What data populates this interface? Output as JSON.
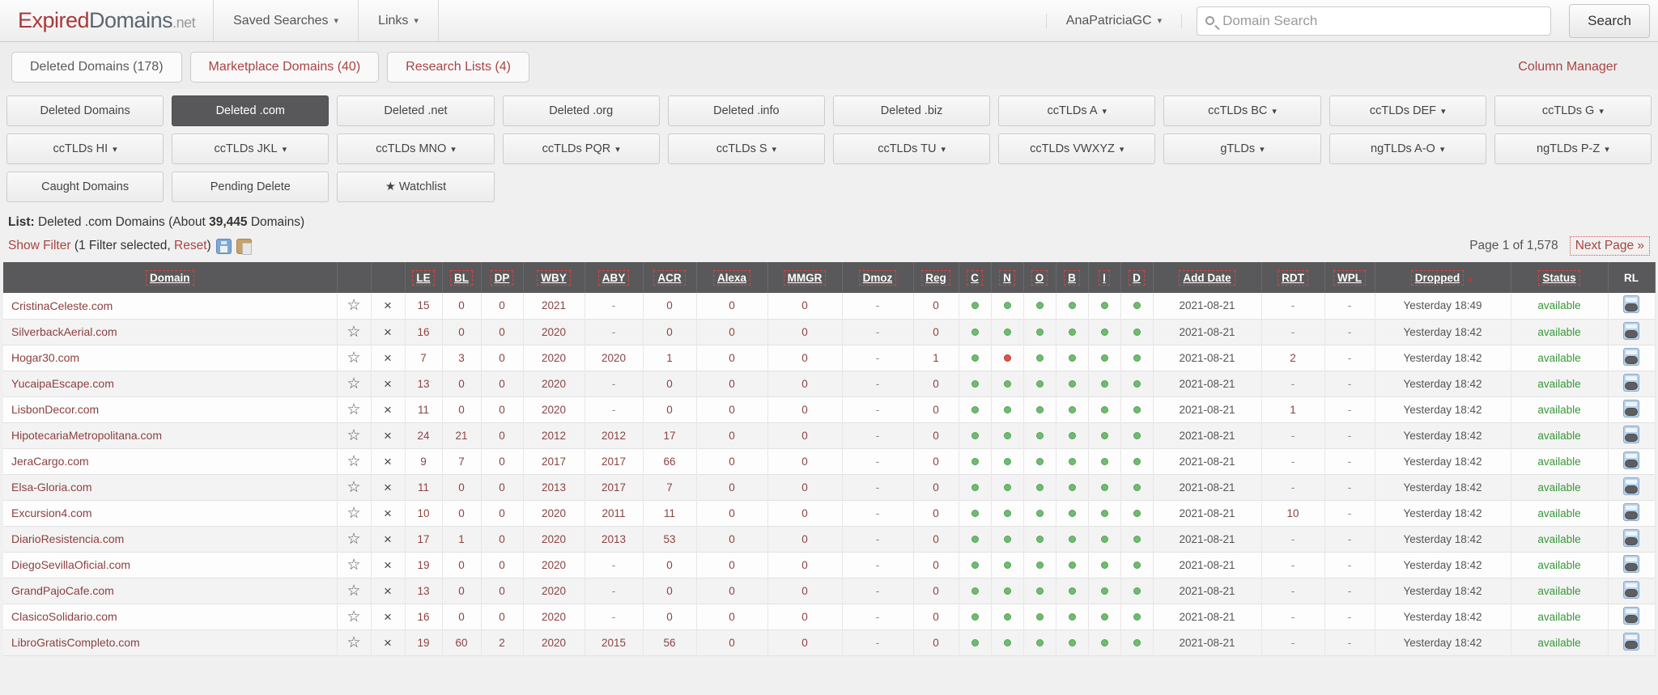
{
  "colors": {
    "accent_red": "#a94442",
    "link_maroon": "#8d4343",
    "status_green": "#389738",
    "dot_green": "#6fbb6f",
    "dot_red": "#d9534f",
    "header_bg": "#59595b"
  },
  "navbar": {
    "logo": {
      "part1": "Expired",
      "part2": "Domains",
      "part3": ".net"
    },
    "menus": [
      {
        "label": "Saved Searches"
      },
      {
        "label": "Links"
      }
    ],
    "user": "AnaPatriciaGC",
    "search": {
      "placeholder": "Domain Search",
      "button": "Search"
    }
  },
  "tabs": [
    {
      "label": "Deleted Domains (178)",
      "active": true
    },
    {
      "label": "Marketplace Domains (40)",
      "active": false
    },
    {
      "label": "Research Lists (4)",
      "active": false
    }
  ],
  "column_manager": "Column Manager",
  "filter_buttons": [
    {
      "label": "Deleted Domains",
      "dropdown": false,
      "active": false
    },
    {
      "label": "Deleted .com",
      "dropdown": false,
      "active": true
    },
    {
      "label": "Deleted .net",
      "dropdown": false,
      "active": false
    },
    {
      "label": "Deleted .org",
      "dropdown": false,
      "active": false
    },
    {
      "label": "Deleted .info",
      "dropdown": false,
      "active": false
    },
    {
      "label": "Deleted .biz",
      "dropdown": false,
      "active": false
    },
    {
      "label": "ccTLDs A",
      "dropdown": true,
      "active": false
    },
    {
      "label": "ccTLDs BC",
      "dropdown": true,
      "active": false
    },
    {
      "label": "ccTLDs DEF",
      "dropdown": true,
      "active": false
    },
    {
      "label": "ccTLDs G",
      "dropdown": true,
      "active": false
    },
    {
      "label": "ccTLDs HI",
      "dropdown": true,
      "active": false
    },
    {
      "label": "ccTLDs JKL",
      "dropdown": true,
      "active": false
    },
    {
      "label": "ccTLDs MNO",
      "dropdown": true,
      "active": false
    },
    {
      "label": "ccTLDs PQR",
      "dropdown": true,
      "active": false
    },
    {
      "label": "ccTLDs S",
      "dropdown": true,
      "active": false
    },
    {
      "label": "ccTLDs TU",
      "dropdown": true,
      "active": false
    },
    {
      "label": "ccTLDs VWXYZ",
      "dropdown": true,
      "active": false
    },
    {
      "label": "gTLDs",
      "dropdown": true,
      "active": false
    },
    {
      "label": "ngTLDs A-O",
      "dropdown": true,
      "active": false
    },
    {
      "label": "ngTLDs P-Z",
      "dropdown": true,
      "active": false
    },
    {
      "label": "Caught Domains",
      "dropdown": false,
      "active": false
    },
    {
      "label": "Pending Delete",
      "dropdown": false,
      "active": false
    },
    {
      "label": "★ Watchlist",
      "dropdown": false,
      "active": false
    }
  ],
  "list_info": {
    "label": "List:",
    "text_before": " Deleted .com Domains (About ",
    "count": "39,445",
    "text_after": " Domains)"
  },
  "filter_bar": {
    "show_filter": "Show Filter",
    "mid": " (1 Filter selected, ",
    "reset": "Reset",
    "close": ")"
  },
  "pagination": {
    "page_info": "Page 1 of 1,578",
    "next": "Next Page »"
  },
  "table": {
    "columns": [
      {
        "key": "domain",
        "label": "Domain",
        "sortable": true
      },
      {
        "key": "favorite",
        "label": "",
        "sortable": false
      },
      {
        "key": "delete",
        "label": "",
        "sortable": false
      },
      {
        "key": "le",
        "label": "LE",
        "sortable": true
      },
      {
        "key": "bl",
        "label": "BL",
        "sortable": true
      },
      {
        "key": "dp",
        "label": "DP",
        "sortable": true
      },
      {
        "key": "wby",
        "label": "WBY",
        "sortable": true
      },
      {
        "key": "aby",
        "label": "ABY",
        "sortable": true
      },
      {
        "key": "acr",
        "label": "ACR",
        "sortable": true
      },
      {
        "key": "alexa",
        "label": "Alexa",
        "sortable": true
      },
      {
        "key": "mmgr",
        "label": "MMGR",
        "sortable": true
      },
      {
        "key": "dmoz",
        "label": "Dmoz",
        "sortable": true
      },
      {
        "key": "reg",
        "label": "Reg",
        "sortable": true
      },
      {
        "key": "c",
        "label": "C",
        "sortable": true
      },
      {
        "key": "n",
        "label": "N",
        "sortable": true
      },
      {
        "key": "o",
        "label": "O",
        "sortable": true
      },
      {
        "key": "b",
        "label": "B",
        "sortable": true
      },
      {
        "key": "i",
        "label": "I",
        "sortable": true
      },
      {
        "key": "d",
        "label": "D",
        "sortable": true
      },
      {
        "key": "add_date",
        "label": "Add Date",
        "sortable": true
      },
      {
        "key": "rdt",
        "label": "RDT",
        "sortable": true
      },
      {
        "key": "wpl",
        "label": "WPL",
        "sortable": true
      },
      {
        "key": "dropped",
        "label": "Dropped",
        "sortable": true,
        "sorted": true
      },
      {
        "key": "status",
        "label": "Status",
        "sortable": true
      },
      {
        "key": "rl",
        "label": "RL",
        "sortable": false
      }
    ],
    "rows": [
      {
        "domain": "CristinaCeleste.com",
        "le": "15",
        "bl": "0",
        "dp": "0",
        "wby": "2021",
        "aby": "-",
        "acr": "0",
        "alexa": "0",
        "mmgr": "0",
        "dmoz": "-",
        "reg": "0",
        "dots": [
          "g",
          "g",
          "g",
          "g",
          "g",
          "g"
        ],
        "add_date": "2021-08-21",
        "rdt": "-",
        "wpl": "-",
        "dropped": "Yesterday 18:49",
        "status": "available"
      },
      {
        "domain": "SilverbackAerial.com",
        "le": "16",
        "bl": "0",
        "dp": "0",
        "wby": "2020",
        "aby": "-",
        "acr": "0",
        "alexa": "0",
        "mmgr": "0",
        "dmoz": "-",
        "reg": "0",
        "dots": [
          "g",
          "g",
          "g",
          "g",
          "g",
          "g"
        ],
        "add_date": "2021-08-21",
        "rdt": "-",
        "wpl": "-",
        "dropped": "Yesterday 18:42",
        "status": "available"
      },
      {
        "domain": "Hogar30.com",
        "le": "7",
        "bl": "3",
        "dp": "0",
        "wby": "2020",
        "aby": "2020",
        "acr": "1",
        "alexa": "0",
        "mmgr": "0",
        "dmoz": "-",
        "reg": "1",
        "dots": [
          "g",
          "r",
          "g",
          "g",
          "g",
          "g"
        ],
        "add_date": "2021-08-21",
        "rdt": "2",
        "wpl": "-",
        "dropped": "Yesterday 18:42",
        "status": "available"
      },
      {
        "domain": "YucaipaEscape.com",
        "le": "13",
        "bl": "0",
        "dp": "0",
        "wby": "2020",
        "aby": "-",
        "acr": "0",
        "alexa": "0",
        "mmgr": "0",
        "dmoz": "-",
        "reg": "0",
        "dots": [
          "g",
          "g",
          "g",
          "g",
          "g",
          "g"
        ],
        "add_date": "2021-08-21",
        "rdt": "-",
        "wpl": "-",
        "dropped": "Yesterday 18:42",
        "status": "available"
      },
      {
        "domain": "LisbonDecor.com",
        "le": "11",
        "bl": "0",
        "dp": "0",
        "wby": "2020",
        "aby": "-",
        "acr": "0",
        "alexa": "0",
        "mmgr": "0",
        "dmoz": "-",
        "reg": "0",
        "dots": [
          "g",
          "g",
          "g",
          "g",
          "g",
          "g"
        ],
        "add_date": "2021-08-21",
        "rdt": "1",
        "wpl": "-",
        "dropped": "Yesterday 18:42",
        "status": "available"
      },
      {
        "domain": "HipotecariaMetropolitana.com",
        "le": "24",
        "bl": "21",
        "dp": "0",
        "wby": "2012",
        "aby": "2012",
        "acr": "17",
        "alexa": "0",
        "mmgr": "0",
        "dmoz": "-",
        "reg": "0",
        "dots": [
          "g",
          "g",
          "g",
          "g",
          "g",
          "g"
        ],
        "add_date": "2021-08-21",
        "rdt": "-",
        "wpl": "-",
        "dropped": "Yesterday 18:42",
        "status": "available"
      },
      {
        "domain": "JeraCargo.com",
        "le": "9",
        "bl": "7",
        "dp": "0",
        "wby": "2017",
        "aby": "2017",
        "acr": "66",
        "alexa": "0",
        "mmgr": "0",
        "dmoz": "-",
        "reg": "0",
        "dots": [
          "g",
          "g",
          "g",
          "g",
          "g",
          "g"
        ],
        "add_date": "2021-08-21",
        "rdt": "-",
        "wpl": "-",
        "dropped": "Yesterday 18:42",
        "status": "available"
      },
      {
        "domain": "Elsa-Gloria.com",
        "le": "11",
        "bl": "0",
        "dp": "0",
        "wby": "2013",
        "aby": "2017",
        "acr": "7",
        "alexa": "0",
        "mmgr": "0",
        "dmoz": "-",
        "reg": "0",
        "dots": [
          "g",
          "g",
          "g",
          "g",
          "g",
          "g"
        ],
        "add_date": "2021-08-21",
        "rdt": "-",
        "wpl": "-",
        "dropped": "Yesterday 18:42",
        "status": "available"
      },
      {
        "domain": "Excursion4.com",
        "le": "10",
        "bl": "0",
        "dp": "0",
        "wby": "2020",
        "aby": "2011",
        "acr": "11",
        "alexa": "0",
        "mmgr": "0",
        "dmoz": "-",
        "reg": "0",
        "dots": [
          "g",
          "g",
          "g",
          "g",
          "g",
          "g"
        ],
        "add_date": "2021-08-21",
        "rdt": "10",
        "wpl": "-",
        "dropped": "Yesterday 18:42",
        "status": "available"
      },
      {
        "domain": "DiarioResistencia.com",
        "le": "17",
        "bl": "1",
        "dp": "0",
        "wby": "2020",
        "aby": "2013",
        "acr": "53",
        "alexa": "0",
        "mmgr": "0",
        "dmoz": "-",
        "reg": "0",
        "dots": [
          "g",
          "g",
          "g",
          "g",
          "g",
          "g"
        ],
        "add_date": "2021-08-21",
        "rdt": "-",
        "wpl": "-",
        "dropped": "Yesterday 18:42",
        "status": "available"
      },
      {
        "domain": "DiegoSevillaOficial.com",
        "le": "19",
        "bl": "0",
        "dp": "0",
        "wby": "2020",
        "aby": "-",
        "acr": "0",
        "alexa": "0",
        "mmgr": "0",
        "dmoz": "-",
        "reg": "0",
        "dots": [
          "g",
          "g",
          "g",
          "g",
          "g",
          "g"
        ],
        "add_date": "2021-08-21",
        "rdt": "-",
        "wpl": "-",
        "dropped": "Yesterday 18:42",
        "status": "available"
      },
      {
        "domain": "GrandPajoCafe.com",
        "le": "13",
        "bl": "0",
        "dp": "0",
        "wby": "2020",
        "aby": "-",
        "acr": "0",
        "alexa": "0",
        "mmgr": "0",
        "dmoz": "-",
        "reg": "0",
        "dots": [
          "g",
          "g",
          "g",
          "g",
          "g",
          "g"
        ],
        "add_date": "2021-08-21",
        "rdt": "-",
        "wpl": "-",
        "dropped": "Yesterday 18:42",
        "status": "available"
      },
      {
        "domain": "ClasicoSolidario.com",
        "le": "16",
        "bl": "0",
        "dp": "0",
        "wby": "2020",
        "aby": "-",
        "acr": "0",
        "alexa": "0",
        "mmgr": "0",
        "dmoz": "-",
        "reg": "0",
        "dots": [
          "g",
          "g",
          "g",
          "g",
          "g",
          "g"
        ],
        "add_date": "2021-08-21",
        "rdt": "-",
        "wpl": "-",
        "dropped": "Yesterday 18:42",
        "status": "available"
      },
      {
        "domain": "LibroGratisCompleto.com",
        "le": "19",
        "bl": "60",
        "dp": "2",
        "wby": "2020",
        "aby": "2015",
        "acr": "56",
        "alexa": "0",
        "mmgr": "0",
        "dmoz": "-",
        "reg": "0",
        "dots": [
          "g",
          "g",
          "g",
          "g",
          "g",
          "g"
        ],
        "add_date": "2021-08-21",
        "rdt": "-",
        "wpl": "-",
        "dropped": "Yesterday 18:42",
        "status": "available"
      }
    ]
  }
}
